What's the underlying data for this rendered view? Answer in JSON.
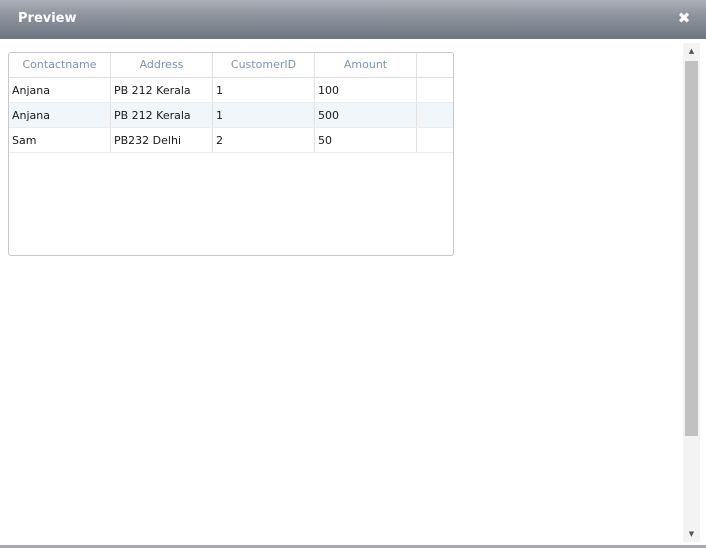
{
  "dialog": {
    "title": "Preview",
    "close_glyph": "✖"
  },
  "grid": {
    "columns": [
      "Contactname",
      "Address",
      "CustomerID",
      "Amount"
    ],
    "rows": [
      [
        "Anjana",
        "PB 212 Kerala",
        "1",
        "100"
      ],
      [
        "Anjana",
        "PB 212 Kerala",
        "1",
        "500"
      ],
      [
        "Sam",
        "PB232 Delhi",
        "2",
        "50"
      ]
    ]
  },
  "scrollbar": {
    "up_glyph": "▲",
    "down_glyph": "▼"
  }
}
